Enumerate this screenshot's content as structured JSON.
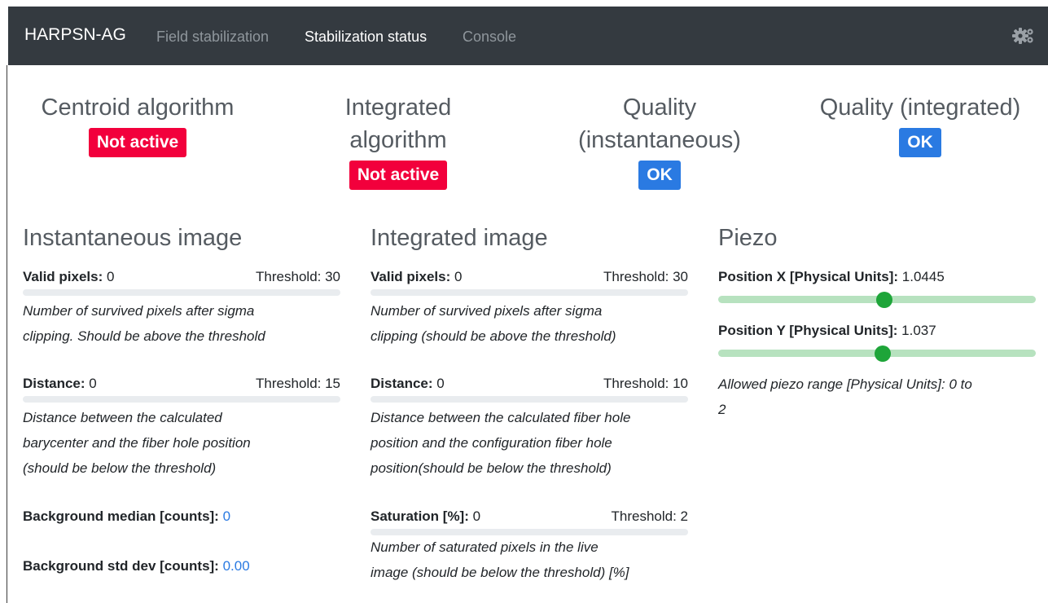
{
  "navbar": {
    "brand": "HARPSN-AG",
    "links": [
      {
        "label": "Field stabilization",
        "active": false
      },
      {
        "label": "Stabilization status",
        "active": true
      },
      {
        "label": "Console",
        "active": false
      }
    ],
    "settings_icon": "gears-icon"
  },
  "status": {
    "centroid": {
      "title_line1": "Centroid algorithm",
      "badge": "Not active",
      "badge_color": "#f2003c"
    },
    "integrated": {
      "title_line1": "Integrated",
      "title_line2": "algorithm",
      "badge": "Not active",
      "badge_color": "#f2003c"
    },
    "quality_inst": {
      "title_line1": "Quality",
      "title_line2": "(instantaneous)",
      "badge": "OK",
      "badge_color": "#2a7ae2"
    },
    "quality_int": {
      "title_line1": "Quality (integrated)",
      "badge": "OK",
      "badge_color": "#2a7ae2"
    }
  },
  "instantaneous": {
    "title": "Instantaneous image",
    "valid_pixels": {
      "label": "Valid pixels:",
      "value": "0",
      "threshold": "Threshold: 30",
      "desc_line1": "Number of survived pixels after sigma",
      "desc_line2": "clipping. Should be above the threshold"
    },
    "distance": {
      "label": "Distance:",
      "value": "0",
      "threshold": "Threshold: 15",
      "desc_line1": "Distance between the calculated",
      "desc_line2": "barycenter and the fiber hole position",
      "desc_line3": "(should be below the threshold)"
    },
    "bg_median": {
      "label": "Background median [counts]:",
      "value": "0"
    },
    "bg_std": {
      "label": "Background std dev [counts]:",
      "value": "0.00"
    }
  },
  "integrated_image": {
    "title": "Integrated image",
    "valid_pixels": {
      "label": "Valid pixels:",
      "value": "0",
      "threshold": "Threshold: 30",
      "desc_line1": "Number of survived pixels after sigma",
      "desc_line2": "clipping (should be above the threshold)"
    },
    "distance": {
      "label": "Distance:",
      "value": "0",
      "threshold": "Threshold: 10",
      "desc_line1": "Distance between the calculated fiber hole",
      "desc_line2": "position and the configuration fiber hole",
      "desc_line3": "position(should be below the threshold)"
    },
    "saturation": {
      "label": "Saturation [%]:",
      "value": "0",
      "threshold": "Threshold: 2",
      "desc_line1": "Number of saturated pixels in the live",
      "desc_line2": "image (should be below the threshold) [%]"
    }
  },
  "piezo": {
    "title": "Piezo",
    "pos_x": {
      "label": "Position X [Physical Units]:",
      "value": "1.0445",
      "fraction": 0.5222
    },
    "pos_y": {
      "label": "Position Y [Physical Units]:",
      "value": "1.037",
      "fraction": 0.5185
    },
    "range_line1": "Allowed piezo range [Physical Units]: 0 to",
    "range_line2": "2",
    "track_color": "#b7e2bf",
    "thumb_color": "#1ea539"
  }
}
